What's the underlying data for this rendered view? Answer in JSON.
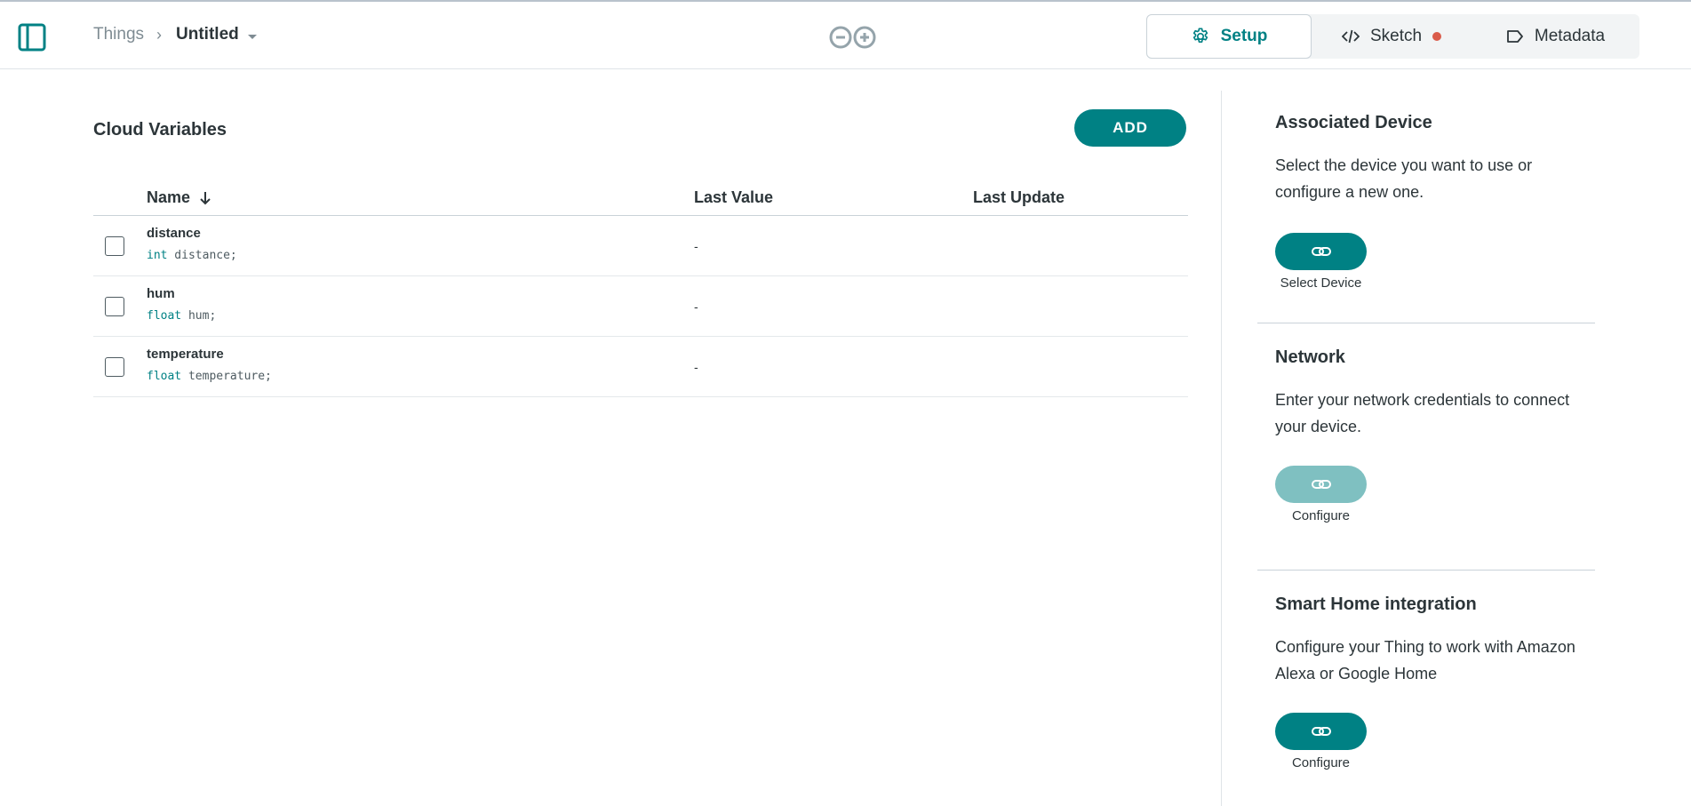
{
  "header": {
    "breadcrumb_root": "Things",
    "breadcrumb_separator": "›",
    "thing_name": "Untitled",
    "tabs": [
      {
        "label": "Setup",
        "icon": "gear-icon",
        "active": true
      },
      {
        "label": "Sketch",
        "icon": "code-icon",
        "has_unsaved_indicator": true
      },
      {
        "label": "Metadata",
        "icon": "tag-icon"
      }
    ]
  },
  "main": {
    "section_title": "Cloud Variables",
    "add_label": "ADD",
    "columns": {
      "name": "Name",
      "last_value": "Last Value",
      "last_update": "Last Update"
    },
    "rows": [
      {
        "name": "distance",
        "type": "int",
        "decl": " distance;",
        "last_value": "-",
        "last_update": ""
      },
      {
        "name": "hum",
        "type": "float",
        "decl": " hum;",
        "last_value": "-",
        "last_update": ""
      },
      {
        "name": "temperature",
        "type": "float",
        "decl": " temperature;",
        "last_value": "-",
        "last_update": ""
      }
    ]
  },
  "panel": {
    "device": {
      "title": "Associated Device",
      "text": "Select the device you want to use or configure a new one.",
      "button_caption": "Select Device"
    },
    "network": {
      "title": "Network",
      "text": "Enter your network credentials to connect your device.",
      "button_caption": "Configure"
    },
    "smart_home": {
      "title": "Smart Home integration",
      "text": "Configure your Thing to work with Amazon Alexa or Google Home",
      "button_caption": "Configure"
    }
  },
  "colors": {
    "accent": "#008184",
    "accent_disabled": "#7fc0c1",
    "unsaved_dot": "#da5b4a",
    "text": "#2c3539",
    "muted": "#7f8c93"
  }
}
